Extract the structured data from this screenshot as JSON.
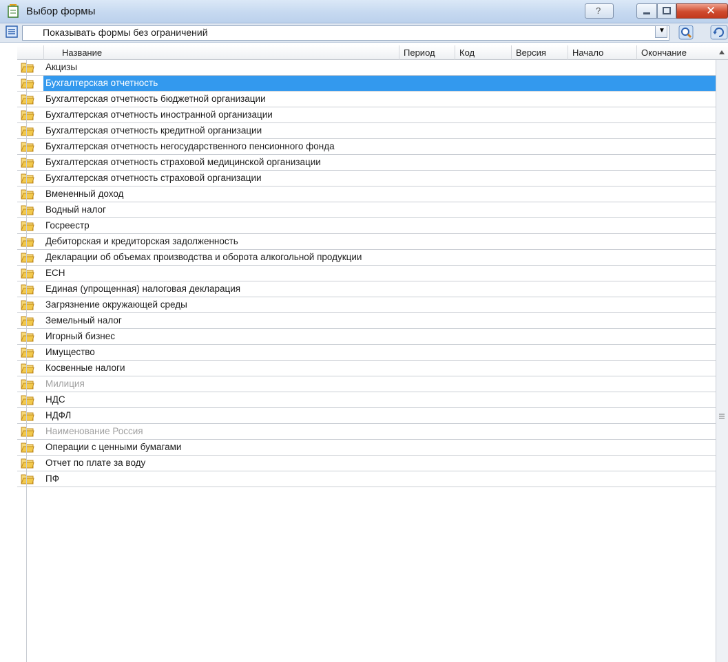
{
  "window": {
    "title": "Выбор формы",
    "help_label": "?",
    "close_label": "✕"
  },
  "toolbar": {
    "filter_value": "Показывать формы без ограничений"
  },
  "grid": {
    "columns": [
      "Название",
      "Период",
      "Код",
      "Версия",
      "Начало",
      "Окончание"
    ],
    "rows": [
      {
        "label": "Акцизы",
        "state": "normal"
      },
      {
        "label": "Бухгалтерская отчетность",
        "state": "selected"
      },
      {
        "label": "Бухгалтерская отчетность бюджетной организации",
        "state": "normal"
      },
      {
        "label": "Бухгалтерская отчетность иностранной организации",
        "state": "normal"
      },
      {
        "label": "Бухгалтерская отчетность кредитной организации",
        "state": "normal"
      },
      {
        "label": "Бухгалтерская отчетность негосударственного пенсионного фонда",
        "state": "normal"
      },
      {
        "label": "Бухгалтерская отчетность страховой медицинской организации",
        "state": "normal"
      },
      {
        "label": "Бухгалтерская отчетность страховой организации",
        "state": "normal"
      },
      {
        "label": "Вмененный доход",
        "state": "normal"
      },
      {
        "label": "Водный налог",
        "state": "normal"
      },
      {
        "label": "Госреестр",
        "state": "normal"
      },
      {
        "label": "Дебиторская и кредиторская задолженность",
        "state": "normal"
      },
      {
        "label": "Декларации об объемах производства и оборота алкогольной продукции",
        "state": "normal"
      },
      {
        "label": "ЕСН",
        "state": "normal"
      },
      {
        "label": "Единая (упрощенная) налоговая декларация",
        "state": "normal"
      },
      {
        "label": "Загрязнение окружающей среды",
        "state": "normal"
      },
      {
        "label": "Земельный налог",
        "state": "normal"
      },
      {
        "label": "Игорный бизнес",
        "state": "normal"
      },
      {
        "label": "Имущество",
        "state": "normal"
      },
      {
        "label": "Косвенные налоги",
        "state": "normal"
      },
      {
        "label": "Милиция",
        "state": "grayed"
      },
      {
        "label": "НДС",
        "state": "normal"
      },
      {
        "label": "НДФЛ",
        "state": "normal"
      },
      {
        "label": "Наименование Россия",
        "state": "grayed"
      },
      {
        "label": "Операции с ценными бумагами",
        "state": "normal"
      },
      {
        "label": "Отчет по плате за воду",
        "state": "normal"
      },
      {
        "label": "ПФ",
        "state": "normal"
      }
    ]
  },
  "colors": {
    "selection": "#3399ee",
    "folder": "#f2c94c"
  },
  "icons": {
    "app": "form-icon",
    "filter": "list-icon",
    "row": "folder-icon",
    "tool1": "preview-icon",
    "tool2": "refresh-icon"
  }
}
